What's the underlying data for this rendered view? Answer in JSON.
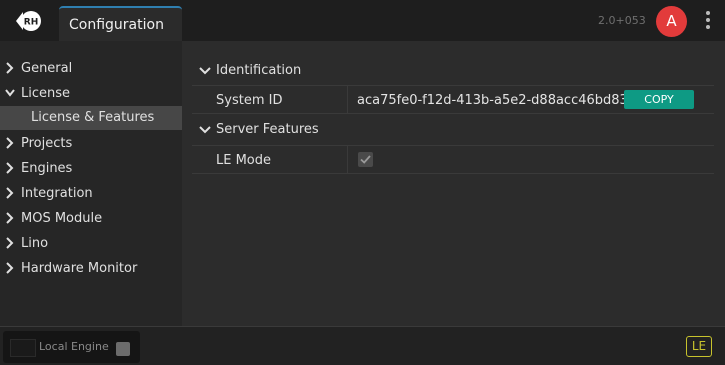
{
  "header": {
    "logo_text": "RH",
    "tab_label": "Configuration",
    "version": "2.0+053",
    "avatar_letter": "A"
  },
  "sidebar": {
    "items": [
      {
        "label": "General",
        "expanded": false
      },
      {
        "label": "License",
        "expanded": true
      },
      {
        "label": "License & Features",
        "child": true,
        "selected": true
      },
      {
        "label": "Projects",
        "expanded": false
      },
      {
        "label": "Engines",
        "expanded": false
      },
      {
        "label": "Integration",
        "expanded": false
      },
      {
        "label": "MOS Module",
        "expanded": false
      },
      {
        "label": "Lino",
        "expanded": false
      },
      {
        "label": "Hardware Monitor",
        "expanded": false
      }
    ]
  },
  "main": {
    "identification": {
      "title": "Identification",
      "system_id_label": "System ID",
      "system_id_value": "aca75fe0-f12d-413b-a5e2-d88acc46bd83",
      "copy_label": "COPY"
    },
    "server_features": {
      "title": "Server Features",
      "le_mode_label": "LE Mode",
      "le_mode_checked": true
    }
  },
  "footer": {
    "engine_label": "Local Engine",
    "badge": "LE"
  },
  "colors": {
    "accent_tab": "#2f7fb0",
    "copy_button": "#0e9a84",
    "avatar": "#e23b3b",
    "le_badge": "#c7c32d"
  }
}
